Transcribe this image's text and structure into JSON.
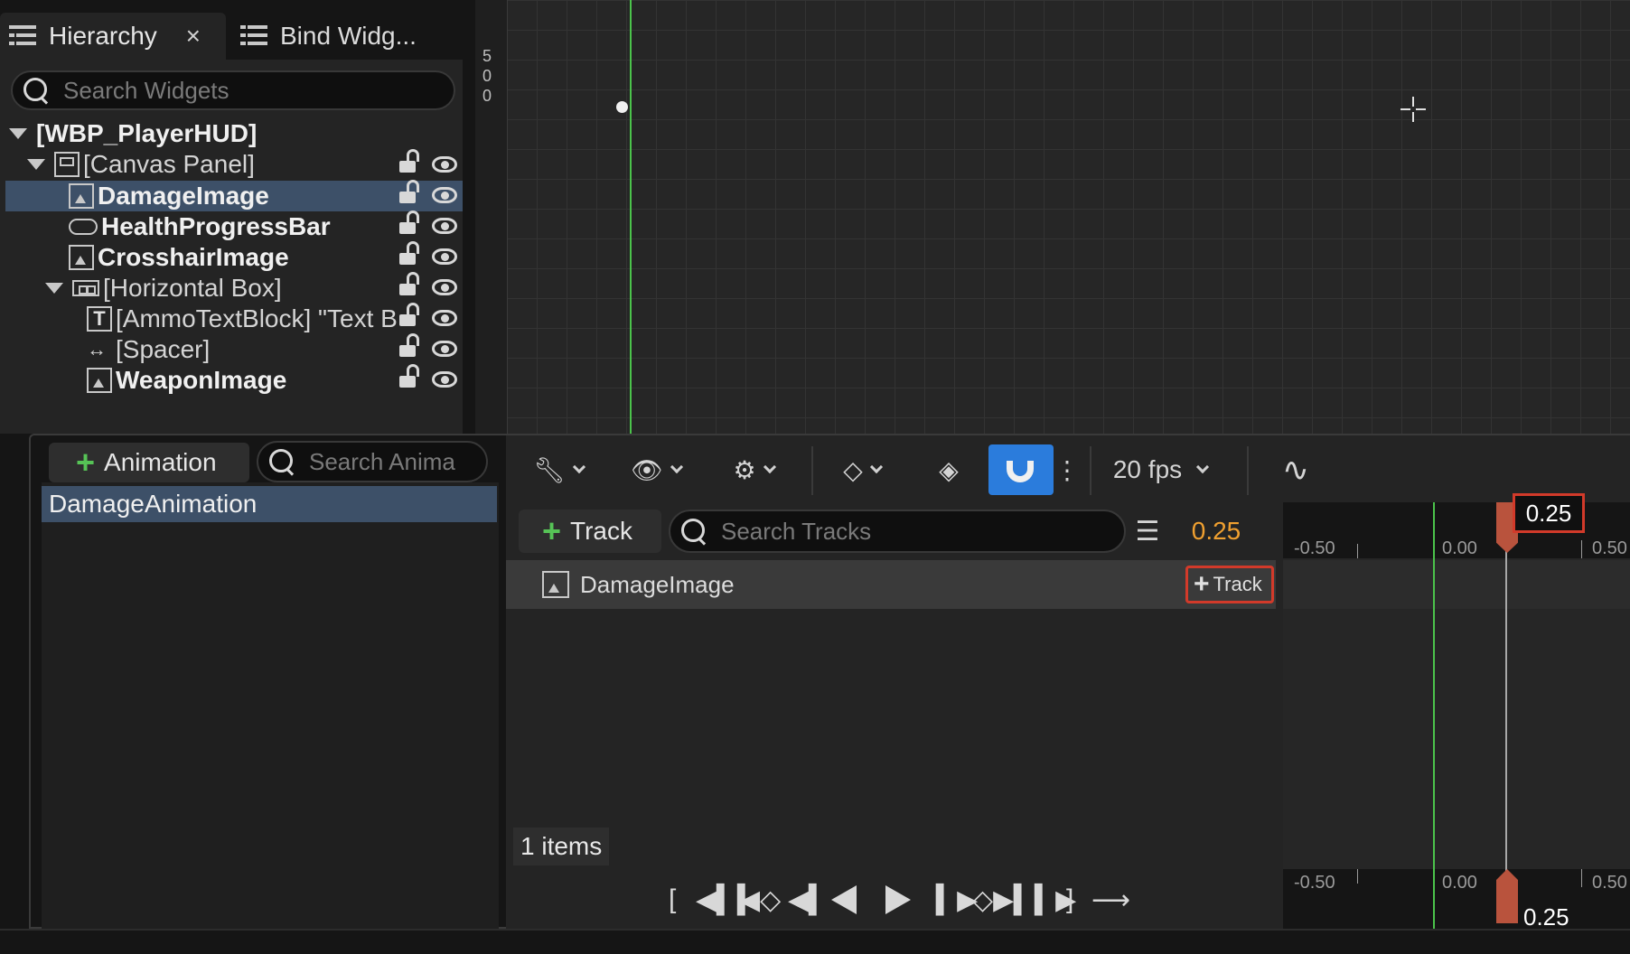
{
  "hierarchy": {
    "tab_label": "Hierarchy",
    "tab_close": "×",
    "second_tab_label": "Bind Widg...",
    "search_placeholder": "Search Widgets",
    "root": "[WBP_PlayerHUD]",
    "items": [
      {
        "label": "[Canvas Panel]",
        "icon": "canvas-panel-icon"
      },
      {
        "label": "DamageImage",
        "icon": "image-icon"
      },
      {
        "label": "HealthProgressBar",
        "icon": "progress-bar-icon"
      },
      {
        "label": "CrosshairImage",
        "icon": "image-icon"
      },
      {
        "label": "[Horizontal Box]",
        "icon": "horizontal-box-icon"
      },
      {
        "label": "[AmmoTextBlock] \"Text B",
        "icon": "text-block-icon"
      },
      {
        "label": "[Spacer]",
        "icon": "spacer-icon"
      },
      {
        "label": "WeaponImage",
        "icon": "image-icon"
      }
    ]
  },
  "canvas": {
    "ruler_digits": [
      "5",
      "0",
      "0"
    ]
  },
  "animations": {
    "add_label": "Animation",
    "search_placeholder": "Search Anima",
    "items": [
      "DamageAnimation"
    ]
  },
  "sequencer": {
    "fps_label": "20 fps",
    "add_track_label": "Track",
    "search_placeholder": "Search Tracks",
    "current_time": "0.25",
    "track_row_label": "DamageImage",
    "row_add_track_label": "Track",
    "items_count": "1 items",
    "ruler_labels": [
      "-0.50",
      "0.00",
      "0.50"
    ],
    "playhead_time": "0.25"
  },
  "colors": {
    "accent_blue": "#2b7cdc",
    "selection": "#3d5068",
    "playhead": "#b9533d",
    "highlight_red": "#d23a2a",
    "start_green": "#4bc34b",
    "time_orange": "#f0a030"
  }
}
